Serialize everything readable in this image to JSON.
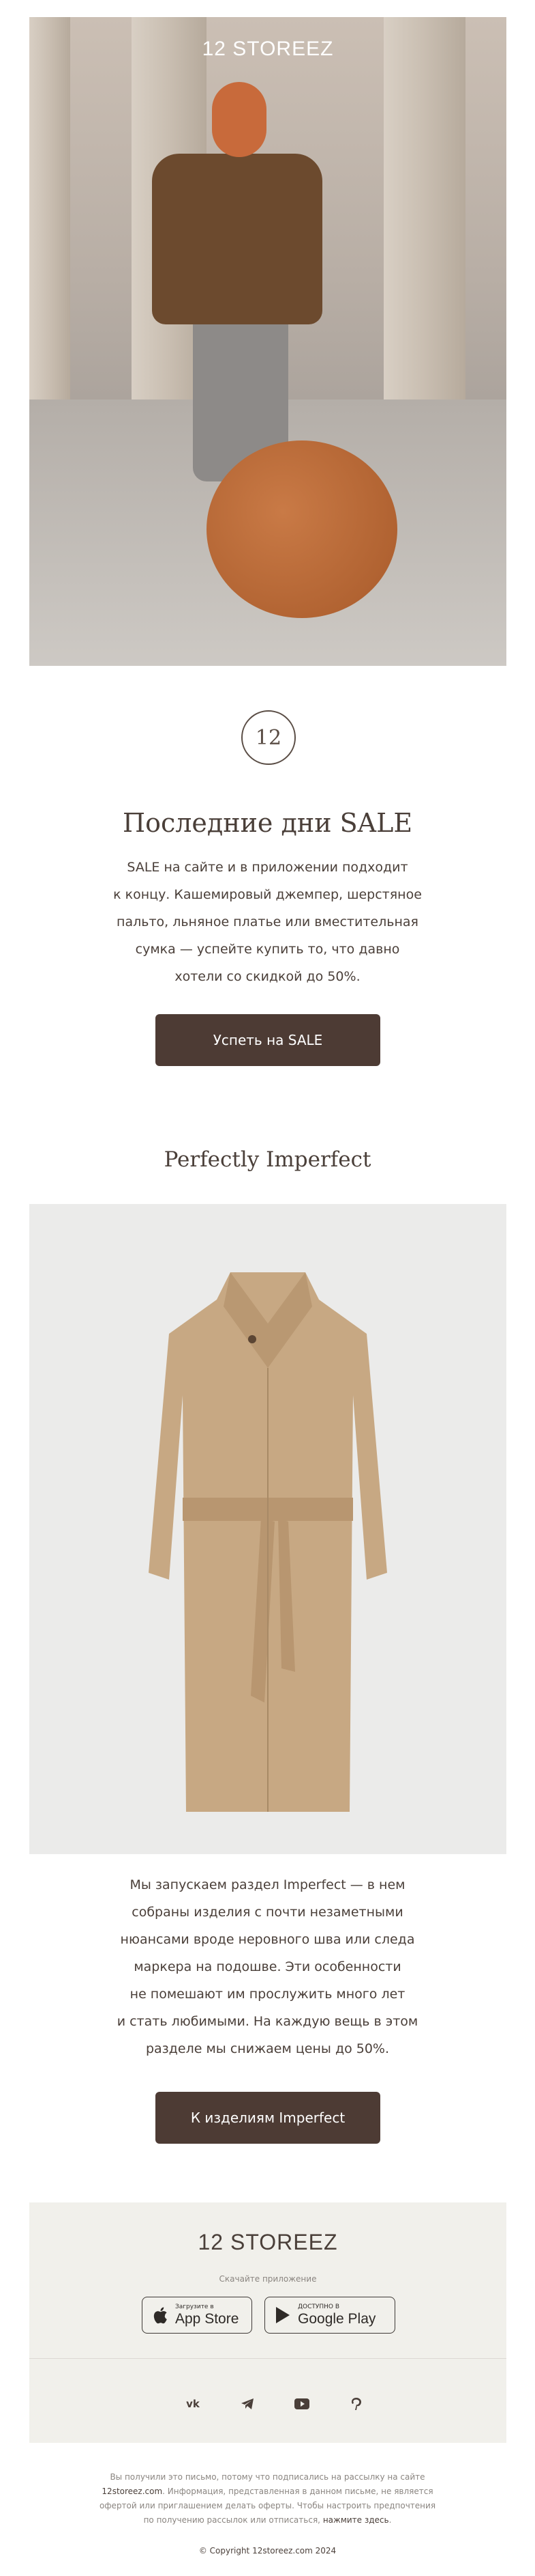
{
  "hero": {
    "brand": "12 STOREEZ"
  },
  "logo": {
    "text": "12"
  },
  "intro": {
    "title": "Последние дни SALE",
    "lines": [
      "SALE на сайте и в приложении подходит",
      "к концу. Кашемировый джемпер, шерстяное",
      "пальто, льняное платье или вместительная",
      "сумка — успейте купить то, что давно",
      "хотели со скидкой до 50%."
    ],
    "cta": "Успеть на SALE"
  },
  "imperfect": {
    "title": "Perfectly Imperfect",
    "lines": [
      "Мы запускаем раздел Imperfect — в нем",
      "собраны изделия с почти незаметными",
      "нюансами вроде неровного шва или следа",
      "маркера на подошве. Эти особенности",
      "не помешают им прослужить много лет",
      "и стать любимыми. На каждую вещь в этом",
      "разделе мы снижаем цены до 50%."
    ],
    "cta": "К изделиям Imperfect"
  },
  "footer": {
    "brand": "12 STOREEZ",
    "download_label": "Скачайте приложение",
    "appstore": {
      "small": "Загрузите в",
      "big": "App Store"
    },
    "googleplay": {
      "small": "ДОСТУПНО В",
      "big": "Google Play"
    },
    "social": [
      "vk-icon",
      "telegram-icon",
      "youtube-icon",
      "pinterest-icon"
    ]
  },
  "legal": {
    "line1": "Вы получили это письмо, потому что подписались на рассылку на сайте",
    "site": "12storeez.com",
    "line2": ". Информация, представленная в данном письме, не является",
    "line3": "офертой или приглашением делать оферты. Чтобы настроить предпочтения",
    "line4": "по получению рассылок или отписаться,",
    "unsubscribe": "нажмите здесь",
    "line4_end": ".",
    "copyright": "© Copyright 12storeez.com 2024"
  },
  "colors": {
    "button": "#4d3b34",
    "text": "#4a3f39",
    "footer_bg": "#f1f0eb",
    "coat_bg": "#ebebea"
  }
}
